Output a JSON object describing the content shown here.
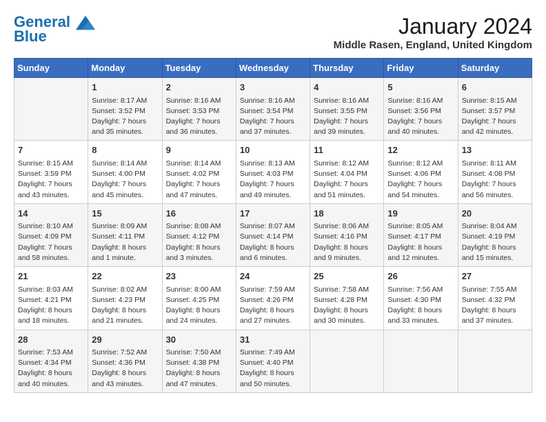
{
  "header": {
    "logo_line1": "General",
    "logo_line2": "Blue",
    "month_title": "January 2024",
    "location": "Middle Rasen, England, United Kingdom"
  },
  "days_of_week": [
    "Sunday",
    "Monday",
    "Tuesday",
    "Wednesday",
    "Thursday",
    "Friday",
    "Saturday"
  ],
  "weeks": [
    [
      {
        "day": "",
        "text": ""
      },
      {
        "day": "1",
        "text": "Sunrise: 8:17 AM\nSunset: 3:52 PM\nDaylight: 7 hours\nand 35 minutes."
      },
      {
        "day": "2",
        "text": "Sunrise: 8:16 AM\nSunset: 3:53 PM\nDaylight: 7 hours\nand 36 minutes."
      },
      {
        "day": "3",
        "text": "Sunrise: 8:16 AM\nSunset: 3:54 PM\nDaylight: 7 hours\nand 37 minutes."
      },
      {
        "day": "4",
        "text": "Sunrise: 8:16 AM\nSunset: 3:55 PM\nDaylight: 7 hours\nand 39 minutes."
      },
      {
        "day": "5",
        "text": "Sunrise: 8:16 AM\nSunset: 3:56 PM\nDaylight: 7 hours\nand 40 minutes."
      },
      {
        "day": "6",
        "text": "Sunrise: 8:15 AM\nSunset: 3:57 PM\nDaylight: 7 hours\nand 42 minutes."
      }
    ],
    [
      {
        "day": "7",
        "text": "Sunrise: 8:15 AM\nSunset: 3:59 PM\nDaylight: 7 hours\nand 43 minutes."
      },
      {
        "day": "8",
        "text": "Sunrise: 8:14 AM\nSunset: 4:00 PM\nDaylight: 7 hours\nand 45 minutes."
      },
      {
        "day": "9",
        "text": "Sunrise: 8:14 AM\nSunset: 4:02 PM\nDaylight: 7 hours\nand 47 minutes."
      },
      {
        "day": "10",
        "text": "Sunrise: 8:13 AM\nSunset: 4:03 PM\nDaylight: 7 hours\nand 49 minutes."
      },
      {
        "day": "11",
        "text": "Sunrise: 8:12 AM\nSunset: 4:04 PM\nDaylight: 7 hours\nand 51 minutes."
      },
      {
        "day": "12",
        "text": "Sunrise: 8:12 AM\nSunset: 4:06 PM\nDaylight: 7 hours\nand 54 minutes."
      },
      {
        "day": "13",
        "text": "Sunrise: 8:11 AM\nSunset: 4:08 PM\nDaylight: 7 hours\nand 56 minutes."
      }
    ],
    [
      {
        "day": "14",
        "text": "Sunrise: 8:10 AM\nSunset: 4:09 PM\nDaylight: 7 hours\nand 58 minutes."
      },
      {
        "day": "15",
        "text": "Sunrise: 8:09 AM\nSunset: 4:11 PM\nDaylight: 8 hours\nand 1 minute."
      },
      {
        "day": "16",
        "text": "Sunrise: 8:08 AM\nSunset: 4:12 PM\nDaylight: 8 hours\nand 3 minutes."
      },
      {
        "day": "17",
        "text": "Sunrise: 8:07 AM\nSunset: 4:14 PM\nDaylight: 8 hours\nand 6 minutes."
      },
      {
        "day": "18",
        "text": "Sunrise: 8:06 AM\nSunset: 4:16 PM\nDaylight: 8 hours\nand 9 minutes."
      },
      {
        "day": "19",
        "text": "Sunrise: 8:05 AM\nSunset: 4:17 PM\nDaylight: 8 hours\nand 12 minutes."
      },
      {
        "day": "20",
        "text": "Sunrise: 8:04 AM\nSunset: 4:19 PM\nDaylight: 8 hours\nand 15 minutes."
      }
    ],
    [
      {
        "day": "21",
        "text": "Sunrise: 8:03 AM\nSunset: 4:21 PM\nDaylight: 8 hours\nand 18 minutes."
      },
      {
        "day": "22",
        "text": "Sunrise: 8:02 AM\nSunset: 4:23 PM\nDaylight: 8 hours\nand 21 minutes."
      },
      {
        "day": "23",
        "text": "Sunrise: 8:00 AM\nSunset: 4:25 PM\nDaylight: 8 hours\nand 24 minutes."
      },
      {
        "day": "24",
        "text": "Sunrise: 7:59 AM\nSunset: 4:26 PM\nDaylight: 8 hours\nand 27 minutes."
      },
      {
        "day": "25",
        "text": "Sunrise: 7:58 AM\nSunset: 4:28 PM\nDaylight: 8 hours\nand 30 minutes."
      },
      {
        "day": "26",
        "text": "Sunrise: 7:56 AM\nSunset: 4:30 PM\nDaylight: 8 hours\nand 33 minutes."
      },
      {
        "day": "27",
        "text": "Sunrise: 7:55 AM\nSunset: 4:32 PM\nDaylight: 8 hours\nand 37 minutes."
      }
    ],
    [
      {
        "day": "28",
        "text": "Sunrise: 7:53 AM\nSunset: 4:34 PM\nDaylight: 8 hours\nand 40 minutes."
      },
      {
        "day": "29",
        "text": "Sunrise: 7:52 AM\nSunset: 4:36 PM\nDaylight: 8 hours\nand 43 minutes."
      },
      {
        "day": "30",
        "text": "Sunrise: 7:50 AM\nSunset: 4:38 PM\nDaylight: 8 hours\nand 47 minutes."
      },
      {
        "day": "31",
        "text": "Sunrise: 7:49 AM\nSunset: 4:40 PM\nDaylight: 8 hours\nand 50 minutes."
      },
      {
        "day": "",
        "text": ""
      },
      {
        "day": "",
        "text": ""
      },
      {
        "day": "",
        "text": ""
      }
    ]
  ]
}
